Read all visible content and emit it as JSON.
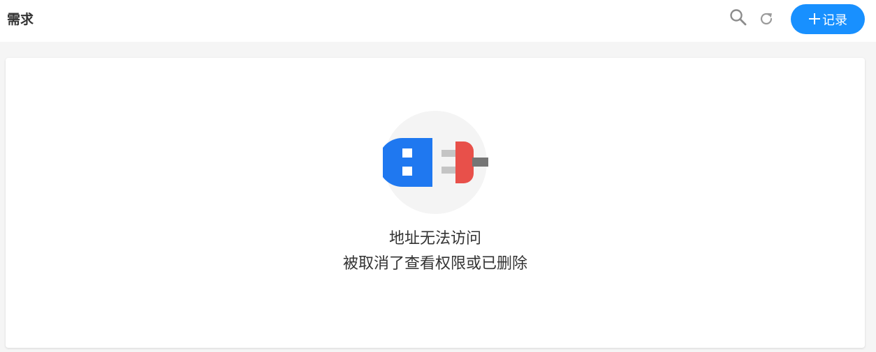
{
  "header": {
    "title": "需求",
    "add_button_label": "记录",
    "icons": {
      "search": "search-icon",
      "refresh": "refresh-icon",
      "add": "plus-icon"
    },
    "accent_color": "#1890ff"
  },
  "main": {
    "error_title": "地址无法访问",
    "error_detail": "被取消了查看权限或已删除",
    "illustration": "unplugged-icon"
  }
}
